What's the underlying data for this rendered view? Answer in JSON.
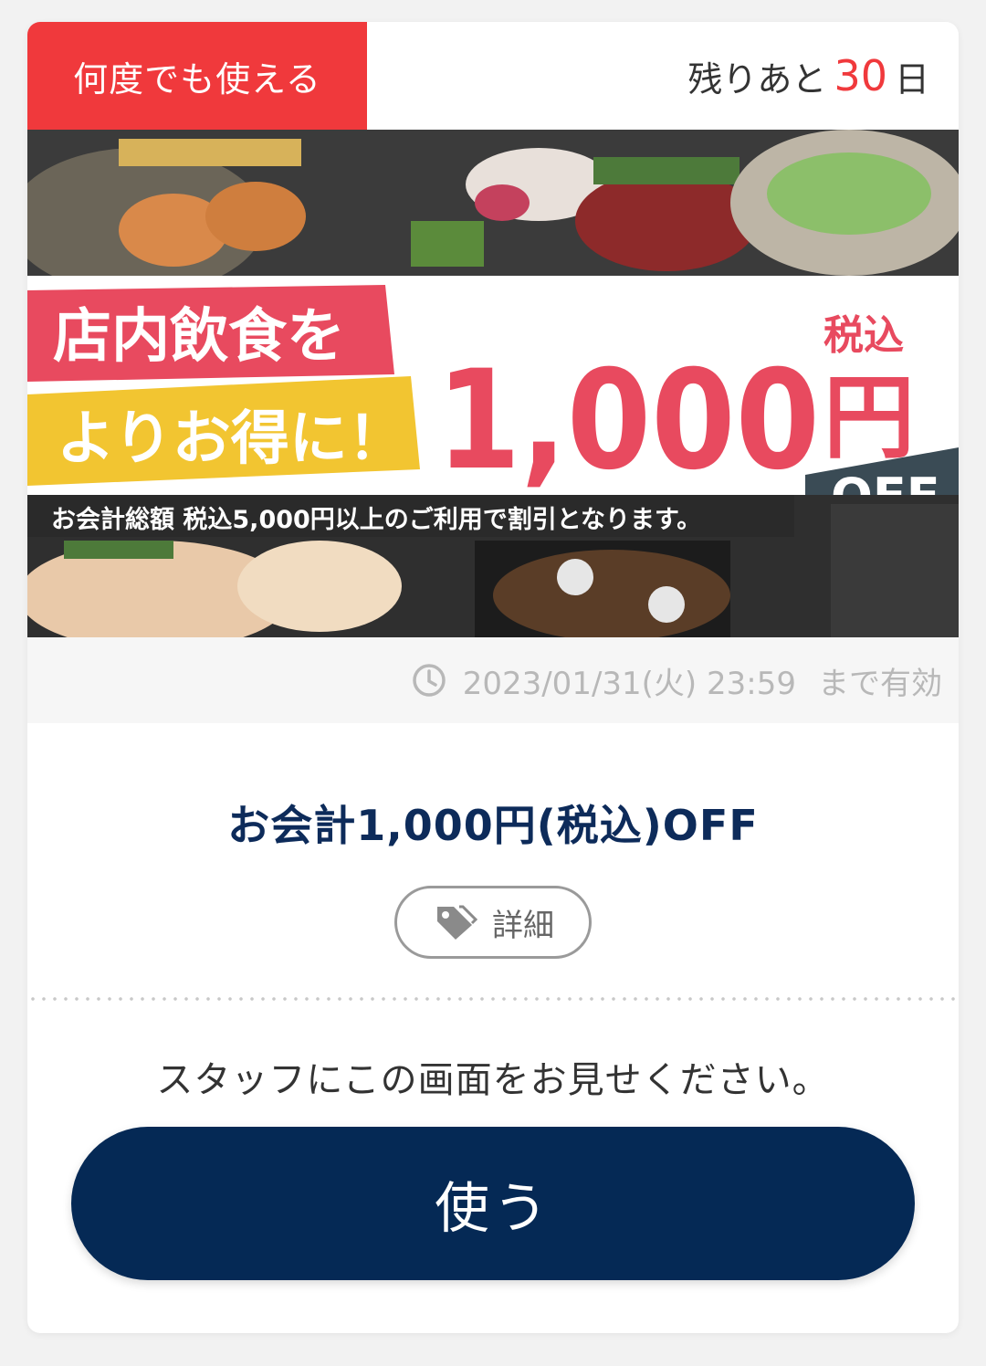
{
  "header": {
    "badge": "何度でも使える",
    "remaining_prefix": "残りあと",
    "remaining_days": "30",
    "remaining_suffix": "日"
  },
  "banner": {
    "headline_line1": "店内飲食を",
    "headline_line2": "よりお得に！",
    "amount": "1,000",
    "tax_label": "税込",
    "yen": "円",
    "off": "OFF",
    "note": "お会計総額 税込5,000円以上のご利用で割引となります。"
  },
  "validity": {
    "icon": "clock-icon",
    "datetime": "2023/01/31(火) 23:59",
    "suffix": "まで有効"
  },
  "coupon": {
    "title": "お会計1,000円(税込)OFF",
    "detail_label": "詳細",
    "detail_icon": "tag-icon"
  },
  "instruction": "スタッフにこの画面をお見せください。",
  "use_button": "使う",
  "colors": {
    "accent_red": "#f0393c",
    "navy": "#052955",
    "banner_red": "#e84a5f",
    "banner_yellow": "#f2c531"
  }
}
